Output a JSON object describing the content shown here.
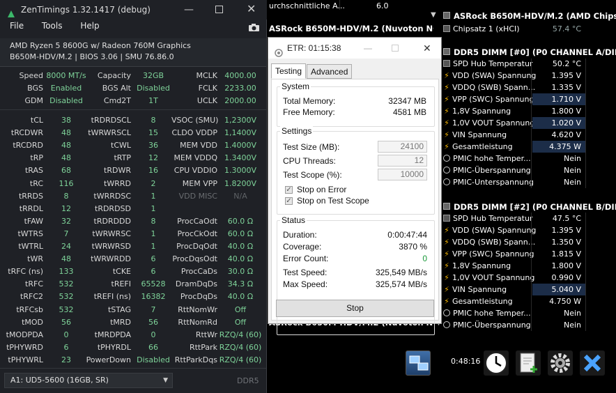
{
  "zentimings": {
    "title": "ZenTimings 1.32.1417 (debug)",
    "menu": [
      "File",
      "Tools",
      "Help"
    ],
    "cpu": "AMD Ryzen 5 8600G w/ Radeon 760M Graphics",
    "board": "B650M-HDV/M.2 | BIOS 3.06 | SMU 76.86.0",
    "top_rows": [
      {
        "l1": "Speed",
        "v1": "8000 MT/s",
        "l2": "Capacity",
        "v2": "32GB",
        "l3": "MCLK",
        "v3": "4000.00"
      },
      {
        "l1": "BGS",
        "v1": "Enabled",
        "l2": "BGS Alt",
        "v2": "Disabled",
        "l3": "FCLK",
        "v3": "2233.00"
      },
      {
        "l1": "GDM",
        "v1": "Disabled",
        "l2": "Cmd2T",
        "v2": "1T",
        "l3": "UCLK",
        "v3": "2000.00"
      }
    ],
    "rows": [
      {
        "l1": "tCL",
        "v1": "38",
        "l2": "tRDRDSCL",
        "v2": "8",
        "l3": "VSOC (SMU)",
        "v3": "1,2300V"
      },
      {
        "l1": "tRCDWR",
        "v1": "48",
        "l2": "tWRWRSCL",
        "v2": "15",
        "l3": "CLDO VDDP",
        "v3": "1,1400V"
      },
      {
        "l1": "tRCDRD",
        "v1": "48",
        "l2": "tCWL",
        "v2": "36",
        "l3": "MEM VDD",
        "v3": "1.4000V"
      },
      {
        "l1": "tRP",
        "v1": "48",
        "l2": "tRTP",
        "v2": "12",
        "l3": "MEM VDDQ",
        "v3": "1.3400V"
      },
      {
        "l1": "tRAS",
        "v1": "68",
        "l2": "tRDWR",
        "v2": "16",
        "l3": "CPU VDDIO",
        "v3": "1.3000V"
      },
      {
        "l1": "tRC",
        "v1": "116",
        "l2": "tWRRD",
        "v2": "2",
        "l3": "MEM VPP",
        "v3": "1.8200V"
      },
      {
        "l1": "tRRDS",
        "v1": "8",
        "l2": "tWRRDSC",
        "v2": "1",
        "l3": "VDD MISC",
        "v3": "N/A"
      },
      {
        "l1": "tRRDL",
        "v1": "12",
        "l2": "tRDRDSD",
        "v2": "1",
        "l3": "",
        "v3": ""
      },
      {
        "l1": "tFAW",
        "v1": "32",
        "l2": "tRDRDDD",
        "v2": "8",
        "l3": "ProcCaOdt",
        "v3": "60.0 Ω"
      },
      {
        "l1": "tWTRS",
        "v1": "7",
        "l2": "tWRWRSC",
        "v2": "1",
        "l3": "ProcCkOdt",
        "v3": "60.0 Ω"
      },
      {
        "l1": "tWTRL",
        "v1": "24",
        "l2": "tWRWRSD",
        "v2": "1",
        "l3": "ProcDqOdt",
        "v3": "40.0 Ω"
      },
      {
        "l1": "tWR",
        "v1": "48",
        "l2": "tWRWRDD",
        "v2": "6",
        "l3": "ProcDqsOdt",
        "v3": "40.0 Ω"
      },
      {
        "l1": "tRFC (ns)",
        "v1": "133",
        "l2": "tCKE",
        "v2": "6",
        "l3": "ProcCaDs",
        "v3": "30.0 Ω"
      },
      {
        "l1": "tRFC",
        "v1": "532",
        "l2": "tREFI",
        "v2": "65528",
        "l3": "DramDqDs",
        "v3": "34.3 Ω"
      },
      {
        "l1": "tRFC2",
        "v1": "532",
        "l2": "tREFI (ns)",
        "v2": "16382",
        "l3": "ProcDqDs",
        "v3": "40.0 Ω"
      },
      {
        "l1": "tRFCsb",
        "v1": "532",
        "l2": "tSTAG",
        "v2": "7",
        "l3": "RttNomWr",
        "v3": "Off"
      },
      {
        "l1": "tMOD",
        "v1": "56",
        "l2": "tMRD",
        "v2": "56",
        "l3": "RttNomRd",
        "v3": "Off"
      },
      {
        "l1": "tMODPDA",
        "v1": "0",
        "l2": "tMRDPDA",
        "v2": "0",
        "l3": "RttWr",
        "v3": "RZQ/4 (60)"
      },
      {
        "l1": "tPHYWRD",
        "v1": "6",
        "l2": "tPHYRDL",
        "v2": "66",
        "l3": "RttPark",
        "v3": "RZQ/4 (60)"
      },
      {
        "l1": "tPHYWRL",
        "v1": "23",
        "l2": "PowerDown",
        "v2": "Disabled",
        "l3": "RttParkDqs",
        "v3": "RZQ/4 (60)"
      }
    ],
    "dimm_select": "A1: UD5-5600 (16GB, SR)",
    "ddr_label": "DDR5"
  },
  "etr": {
    "title": "ETR: 01:15:38",
    "tabs": [
      "Testing",
      "Advanced"
    ],
    "system_title": "System",
    "total_memory_label": "Total Memory:",
    "total_memory": "32347 MB",
    "free_memory_label": "Free Memory:",
    "free_memory": "4581 MB",
    "settings_title": "Settings",
    "test_size_label": "Test Size (MB):",
    "test_size": "24100",
    "cpu_threads_label": "CPU Threads:",
    "cpu_threads": "12",
    "test_scope_label": "Test Scope (%):",
    "test_scope": "10000",
    "stop_on_error": "Stop on Error",
    "stop_on_scope": "Stop on Test Scope",
    "status_title": "Status",
    "duration_label": "Duration:",
    "duration": "0:00:47:44",
    "coverage_label": "Coverage:",
    "coverage": "3870 %",
    "error_count_label": "Error Count:",
    "error_count": "0",
    "test_speed_label": "Test Speed:",
    "test_speed": "325,549 MB/s",
    "max_speed_label": "Max Speed:",
    "max_speed": "325,574 MB/s",
    "stop_button": "Stop"
  },
  "hwinfo": {
    "top_left_label": "urchschnittliche A...",
    "top_left_value": "6.0",
    "nuvoton_header": "ASRock B650M-HDV/M.2 (Nuvoton NCT67",
    "chipset_header": "ASRock B650M-HDV/M.2 (AMD Chipsat",
    "chipset_row": {
      "label": "Chipsatz 1 (xHCI)",
      "value": "57.4 °C"
    },
    "dimm0_header": "DDR5 DIMM [#0] (P0 CHANNEL A/DIMM",
    "dimm0_rows": [
      {
        "label": "SPD Hub Temperatur",
        "value": "50.2 °C",
        "icon": "chip"
      },
      {
        "label": "VDD (SWA) Spannung",
        "value": "1.395 V",
        "icon": "bolt"
      },
      {
        "label": "VDDQ (SWB) Spann...",
        "value": "1.335 V",
        "icon": "bolt"
      },
      {
        "label": "VPP (SWC) Spannung",
        "value": "1.710 V",
        "icon": "bolt",
        "hl": true
      },
      {
        "label": "1,8V Spannung",
        "value": "1.800 V",
        "icon": "bolt"
      },
      {
        "label": "1,0V VOUT Spannung",
        "value": "1.020 V",
        "icon": "bolt",
        "hl": true
      },
      {
        "label": "VIN Spannung",
        "value": "4.620 V",
        "icon": "bolt"
      },
      {
        "label": "Gesamtleistung",
        "value": "4.375 W",
        "icon": "bolt",
        "hl": true
      },
      {
        "label": "PMIC hohe Temper...",
        "value": "Nein",
        "icon": "clock"
      },
      {
        "label": "PMIC-Überspannung",
        "value": "Nein",
        "icon": "clock"
      },
      {
        "label": "PMIC-Unterspannung",
        "value": "Nein",
        "icon": "clock"
      }
    ],
    "dimm2_header": "DDR5 DIMM [#2] (P0 CHANNEL B/DIMM",
    "dimm2_rows": [
      {
        "label": "SPD Hub Temperatur",
        "value": "47.5 °C",
        "icon": "chip"
      },
      {
        "label": "VDD (SWA) Spannung",
        "value": "1.395 V",
        "icon": "bolt"
      },
      {
        "label": "VDDQ (SWB) Spann...",
        "value": "1.350 V",
        "icon": "bolt"
      },
      {
        "label": "VPP (SWC) Spannung",
        "value": "1.815 V",
        "icon": "bolt"
      },
      {
        "label": "1,8V Spannung",
        "value": "1.800 V",
        "icon": "bolt"
      },
      {
        "label": "1,0V VOUT Spannung",
        "value": "0.990 V",
        "icon": "bolt"
      },
      {
        "label": "VIN Spannung",
        "value": "5.040 V",
        "icon": "bolt",
        "hl": true
      },
      {
        "label": "Gesamtleistung",
        "value": "4.750 W",
        "icon": "bolt"
      },
      {
        "label": "PMIC hohe Temper...",
        "value": "Nein",
        "icon": "clock"
      },
      {
        "label": "PMIC-Überspannung",
        "value": "Nein",
        "icon": "clock"
      }
    ],
    "nuvoton_partial_row": "ASRock B650M-HDV/M.2 (Nuvoton NCT67",
    "timer": "0:48:16"
  }
}
